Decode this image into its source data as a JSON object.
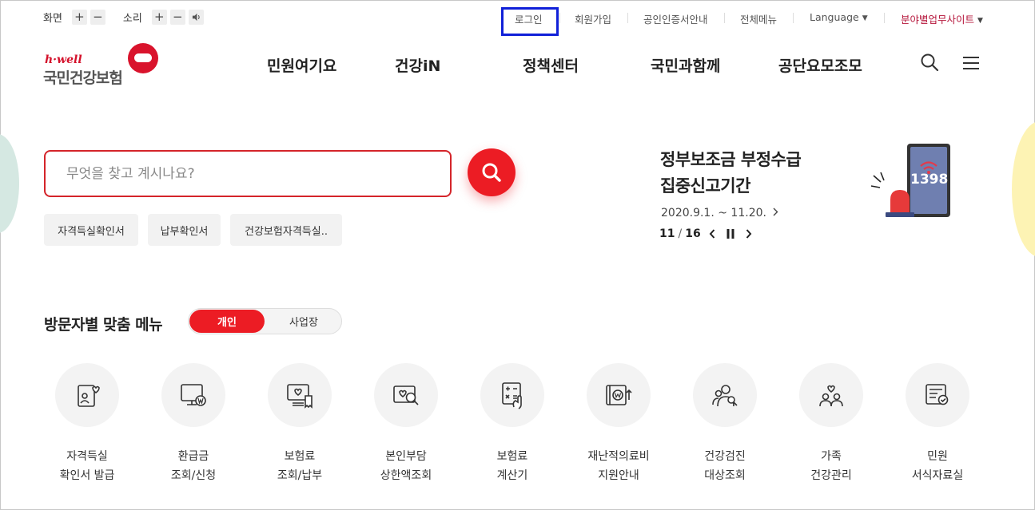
{
  "util": {
    "screen_label": "화면",
    "sound_label": "소리",
    "plus": "+",
    "minus": "−",
    "links": {
      "login": "로그인",
      "join": "회원가입",
      "cert": "공인인증서안내",
      "allmenu": "전체메뉴",
      "language": "Language",
      "sites": "분야별업무사이트"
    }
  },
  "logo": {
    "small": "h·well",
    "main": "국민건강보험"
  },
  "gnb": [
    "민원여기요",
    "건강iN",
    "정책센터",
    "국민과함께",
    "공단요모조모"
  ],
  "search": {
    "placeholder": "무엇을 찾고 계시나요?"
  },
  "quick_chips": [
    "자격득실확인서",
    "납부확인서",
    "건강보험자격득실.."
  ],
  "notice": {
    "title_line1": "정부보조금 부정수급",
    "title_line2": "집중신고기간",
    "date": "2020.9.1. ~ 11.20.",
    "current": "11",
    "total": "16",
    "badge": "1398"
  },
  "menu_section": {
    "title": "방문자별 맞춤 메뉴",
    "tab_personal": "개인",
    "tab_business": "사업장"
  },
  "services": [
    {
      "line1": "자격득실",
      "line2": "확인서 발급",
      "icon": "id-card-heart-icon"
    },
    {
      "line1": "환급금",
      "line2": "조회/신청",
      "icon": "monitor-won-icon"
    },
    {
      "line1": "보험료",
      "line2": "조회/납부",
      "icon": "bill-heart-icon"
    },
    {
      "line1": "본인부담",
      "line2": "상한액조회",
      "icon": "heart-search-icon"
    },
    {
      "line1": "보험료",
      "line2": "계산기",
      "icon": "calculator-hand-icon"
    },
    {
      "line1": "재난적의료비",
      "line2": "지원안내",
      "icon": "won-support-icon"
    },
    {
      "line1": "건강검진",
      "line2": "대상조회",
      "icon": "people-search-icon"
    },
    {
      "line1": "가족",
      "line2": "건강관리",
      "icon": "family-heart-icon"
    },
    {
      "line1": "민원",
      "line2": "서식자료실",
      "icon": "document-search-icon"
    }
  ],
  "colors": {
    "brand_red": "#ec1c24",
    "focus_blue": "#1020d8",
    "site_link": "#b5143a"
  }
}
